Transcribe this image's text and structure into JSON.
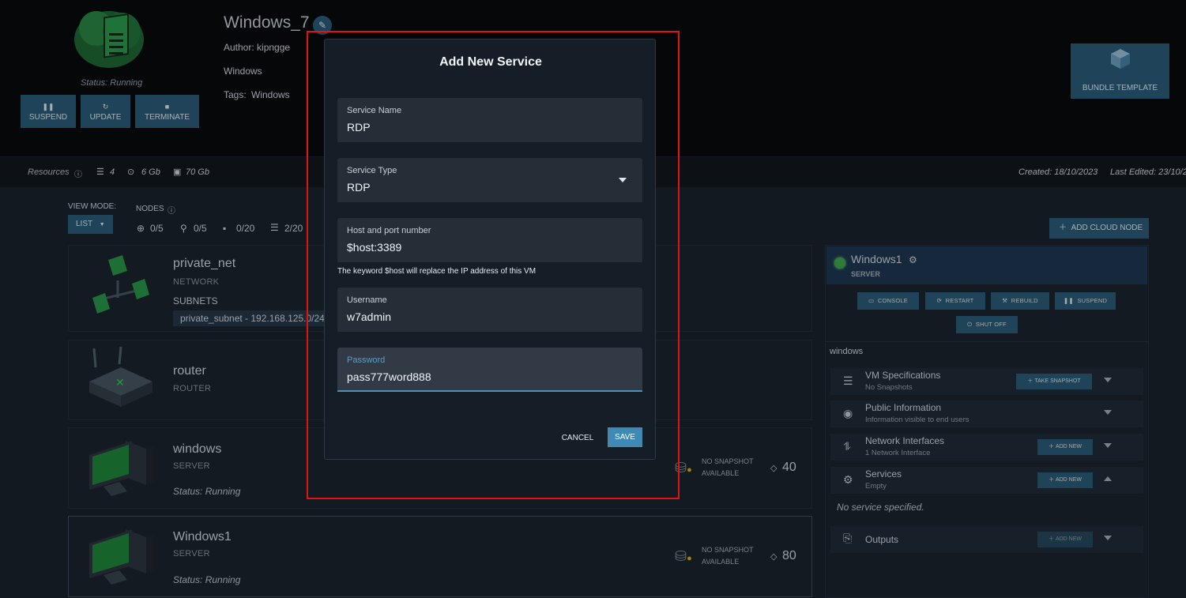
{
  "header": {
    "status": "Status: Running",
    "title": "Windows_7",
    "author": "Author: kipngge",
    "os": "Windows",
    "tags_label": "Tags:",
    "tags_value": "Windows",
    "buttons": {
      "suspend": "SUSPEND",
      "update": "UPDATE",
      "terminate": "TERMINATE",
      "bundle": "BUNDLE TEMPLATE"
    }
  },
  "stats": {
    "resources_label": "Resources",
    "cpus": "4",
    "ram": "6 Gb",
    "disk": "70 Gb",
    "created": "Created: 18/10/2023",
    "last_edited": "Last Edited: 23/10/2"
  },
  "toolbar": {
    "view_mode_label": "VIEW MODE:",
    "view_mode_value": "LIST",
    "nodes_label": "NODES",
    "counts": [
      "0/5",
      "0/5",
      "0/20",
      "2/20"
    ],
    "add_cloud_node": "ADD CLOUD NODE"
  },
  "nodes": [
    {
      "name": "private_net",
      "type": "NETWORK",
      "subnets_label": "SUBNETS",
      "subnet": "private_subnet - 192.168.125.0/24"
    },
    {
      "name": "router",
      "type": "ROUTER"
    },
    {
      "name": "windows",
      "type": "SERVER",
      "status": "Status: Running",
      "snapshot": "NO SNAPSHOT",
      "snapshot2": "AVAILABLE",
      "cost": "40"
    },
    {
      "name": "Windows1",
      "type": "SERVER",
      "status": "Status: Running",
      "snapshot": "NO SNAPSHOT",
      "snapshot2": "AVAILABLE",
      "cost": "80"
    }
  ],
  "panel": {
    "server_name": "Windows1",
    "server_type": "SERVER",
    "actions": {
      "console": "CONSOLE",
      "restart": "RESTART",
      "rebuild": "REBUILD",
      "suspend": "SUSPEND",
      "shutoff": "SHUT OFF"
    },
    "image": "windows",
    "sections": [
      {
        "title": "VM Specifications",
        "subtitle": "No Snapshots",
        "action": "TAKE SNAPSHOT"
      },
      {
        "title": "Public Information",
        "subtitle": "Information visible to end users"
      },
      {
        "title": "Network Interfaces",
        "subtitle": "1 Network Interface",
        "action": "ADD NEW"
      },
      {
        "title": "Services",
        "subtitle": "Empty",
        "action": "ADD NEW"
      },
      {
        "title": "Outputs",
        "action": "ADD NEW"
      }
    ],
    "no_service": "No service specified."
  },
  "dialog": {
    "title": "Add New Service",
    "service_name_label": "Service Name",
    "service_name_value": "RDP",
    "service_type_label": "Service Type",
    "service_type_value": "RDP",
    "host_label": "Host and port number",
    "host_value": "$host:3389",
    "host_hint": "The keyword $host will replace the IP address of this VM",
    "username_label": "Username",
    "username_value": "w7admin",
    "password_label": "Password",
    "password_value": "pass777word888",
    "cancel": "CANCEL",
    "save": "SAVE"
  },
  "colors": {
    "accent": "#2c5f7c",
    "highlight": "#e01414",
    "field_focus": "#4d8fb5"
  }
}
